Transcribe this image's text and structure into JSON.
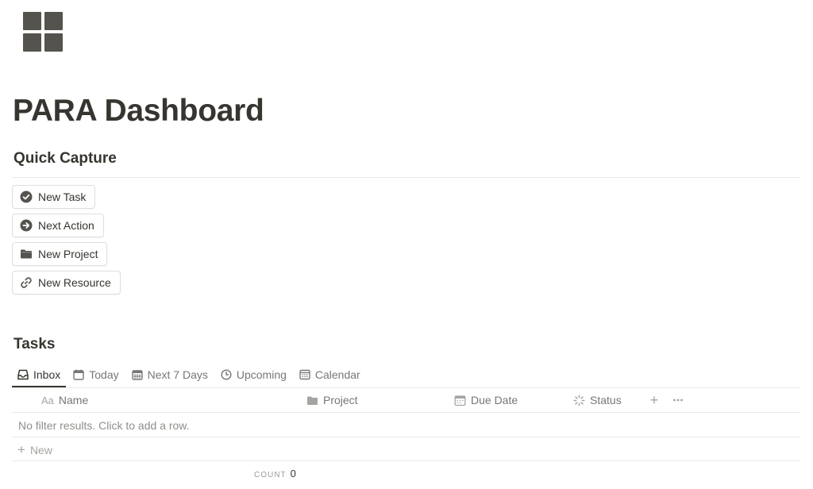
{
  "page": {
    "icon": "grid-icon",
    "title": "PARA Dashboard"
  },
  "quick_capture": {
    "heading": "Quick Capture",
    "buttons": [
      {
        "label": "New Task",
        "icon": "check-circle-icon"
      },
      {
        "label": "Next Action",
        "icon": "arrow-circle-icon"
      },
      {
        "label": "New Project",
        "icon": "folder-icon"
      },
      {
        "label": "New Resource",
        "icon": "link-icon"
      }
    ]
  },
  "tasks": {
    "heading": "Tasks",
    "tabs": [
      {
        "label": "Inbox",
        "icon": "inbox-icon",
        "active": true
      },
      {
        "label": "Today",
        "icon": "calendar-icon"
      },
      {
        "label": "Next 7 Days",
        "icon": "calendar-grid-icon"
      },
      {
        "label": "Upcoming",
        "icon": "clock-icon"
      },
      {
        "label": "Calendar",
        "icon": "calendar-view-icon"
      }
    ],
    "columns": [
      {
        "label": "Name",
        "prefix": "Aa"
      },
      {
        "label": "Project",
        "icon": "folder-icon"
      },
      {
        "label": "Due Date",
        "icon": "calendar-icon"
      },
      {
        "label": "Status",
        "icon": "status-spinner-icon"
      }
    ],
    "empty_message": "No filter results. Click to add a row.",
    "new_label": "New",
    "count_label": "COUNT",
    "count_value": "0"
  },
  "colors": {
    "text": "#37352f",
    "muted": "#787774",
    "border": "#e9e9e7"
  }
}
